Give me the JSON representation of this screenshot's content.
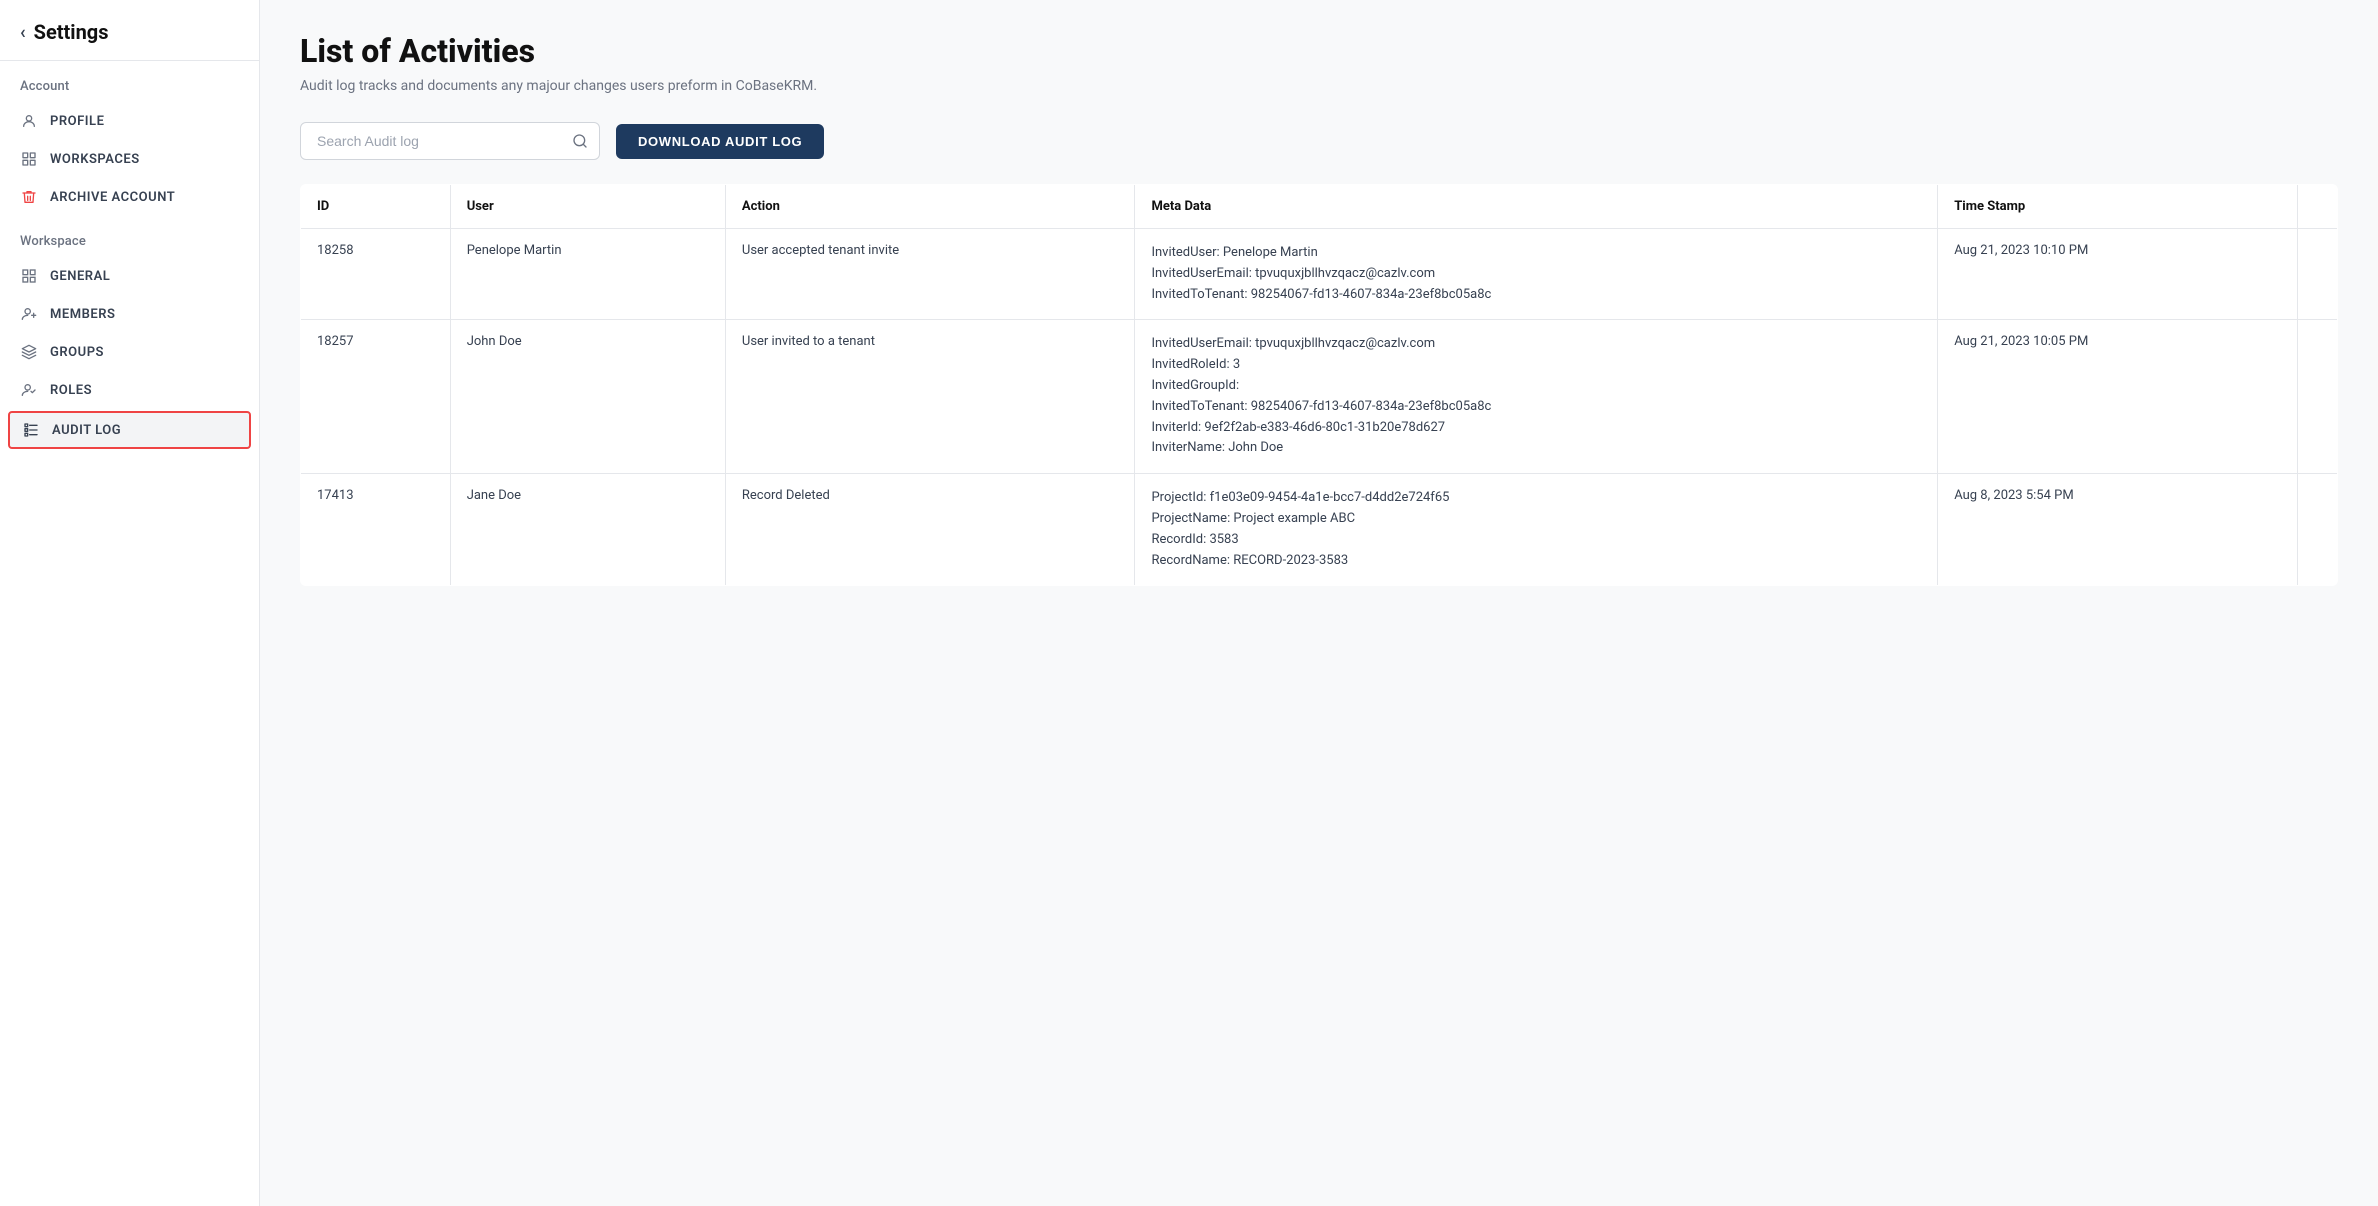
{
  "sidebar": {
    "back_label": "Settings",
    "account_section": "Account",
    "workspace_section": "Workspace",
    "items_account": [
      {
        "id": "profile",
        "label": "PROFILE",
        "icon": "person"
      },
      {
        "id": "workspaces",
        "label": "WORKSPACES",
        "icon": "grid"
      },
      {
        "id": "archive-account",
        "label": "ARCHIVE ACCOUNT",
        "icon": "trash"
      }
    ],
    "items_workspace": [
      {
        "id": "general",
        "label": "GENERAL",
        "icon": "grid-small"
      },
      {
        "id": "members",
        "label": "MEMBERS",
        "icon": "person-add"
      },
      {
        "id": "groups",
        "label": "GROUPS",
        "icon": "layers"
      },
      {
        "id": "roles",
        "label": "ROLES",
        "icon": "person-check"
      },
      {
        "id": "audit-log",
        "label": "AUDIT LOG",
        "icon": "list",
        "active": true
      }
    ]
  },
  "main": {
    "title": "List of Activities",
    "subtitle": "Audit log tracks and documents any majour changes users preform in CoBaseKRM.",
    "search_placeholder": "Search Audit log",
    "download_btn": "DOWNLOAD AUDIT LOG",
    "table": {
      "columns": [
        "ID",
        "User",
        "Action",
        "Meta Data",
        "Time Stamp"
      ],
      "rows": [
        {
          "id": "18258",
          "user": "Penelope Martin",
          "action": "User accepted tenant invite",
          "meta_data": "InvitedUser: Penelope Martin\nInvitedUserEmail: tpvuquxjbllhvzqacz@cazlv.com\nInvitedToTenant: 98254067-fd13-4607-834a-23ef8bc05a8c",
          "timestamp": "Aug 21, 2023 10:10 PM"
        },
        {
          "id": "18257",
          "user": "John Doe",
          "action": "User invited to a tenant",
          "meta_data": "InvitedUserEmail: tpvuquxjbllhvzqacz@cazlv.com\nInvitedRoleId: 3\nInvitedGroupId:\nInvitedToTenant: 98254067-fd13-4607-834a-23ef8bc05a8c\nInviterId: 9ef2f2ab-e383-46d6-80c1-31b20e78d627\nInviterName: John Doe",
          "timestamp": "Aug 21, 2023 10:05 PM"
        },
        {
          "id": "17413",
          "user": "Jane Doe",
          "action": "Record Deleted",
          "meta_data": "ProjectId: f1e03e09-9454-4a1e-bcc7-d4dd2e724f65\nProjectName: Project example ABC\nRecordId: 3583\nRecordName: RECORD-2023-3583",
          "timestamp": "Aug 8, 2023 5:54 PM"
        }
      ]
    }
  }
}
